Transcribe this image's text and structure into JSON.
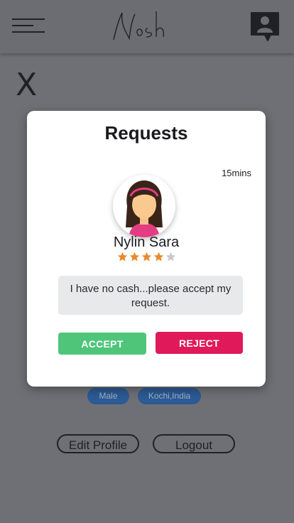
{
  "header": {
    "menu_icon": "hamburger-menu-icon",
    "logo_text": "Nosh",
    "profile_icon": "user-chat-icon"
  },
  "background": {
    "close_label": "X",
    "tags": [
      "Male",
      "Kochi,India"
    ],
    "edit_profile_label": "Edit Profile",
    "logout_label": "Logout"
  },
  "modal": {
    "title": "Requests",
    "time": "15mins",
    "name": "Nylin Sara",
    "rating": 4,
    "rating_max": 5,
    "message": "I have no cash...please accept my request.",
    "accept_label": "ACCEPT",
    "reject_label": "REJECT"
  },
  "colors": {
    "accept": "#4fc57a",
    "reject": "#e0195a",
    "star_filled": "#e8892a",
    "star_empty": "#c9c9c9"
  }
}
